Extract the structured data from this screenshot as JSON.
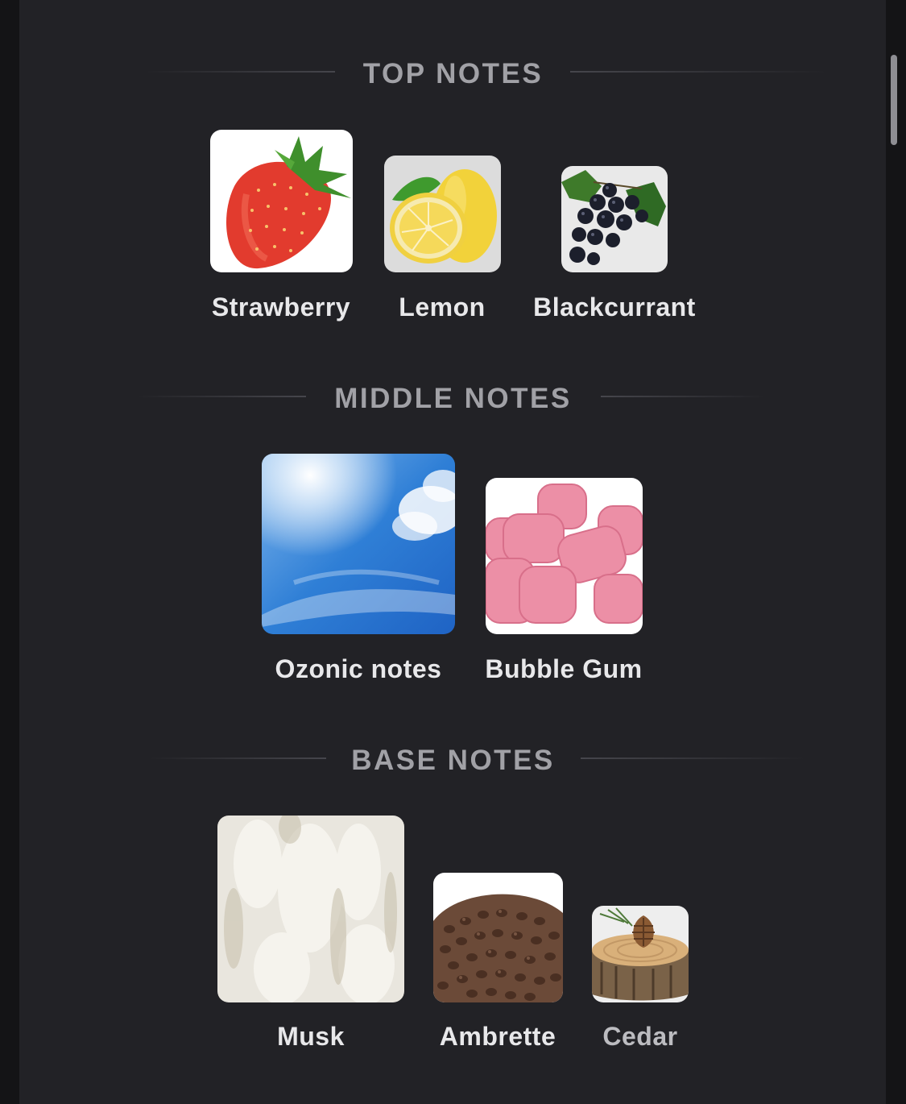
{
  "sections": {
    "top": {
      "title": "TOP NOTES",
      "notes": [
        {
          "label": "Strawberry",
          "icon": "strawberry-image"
        },
        {
          "label": "Lemon",
          "icon": "lemon-image"
        },
        {
          "label": "Blackcurrant",
          "icon": "blackcurrant-image"
        }
      ]
    },
    "middle": {
      "title": "MIDDLE NOTES",
      "notes": [
        {
          "label": "Ozonic notes",
          "icon": "sky-image"
        },
        {
          "label": "Bubble Gum",
          "icon": "bubble-gum-image"
        }
      ]
    },
    "base": {
      "title": "BASE NOTES",
      "notes": [
        {
          "label": "Musk",
          "icon": "musk-image"
        },
        {
          "label": "Ambrette",
          "icon": "ambrette-seeds-image"
        },
        {
          "label": "Cedar",
          "icon": "cedar-pinecone-image"
        }
      ]
    }
  },
  "colors": {
    "background": "#141416",
    "panel": "#222226",
    "header_text": "#a1a1a6",
    "label_text": "#e8e8ea"
  }
}
